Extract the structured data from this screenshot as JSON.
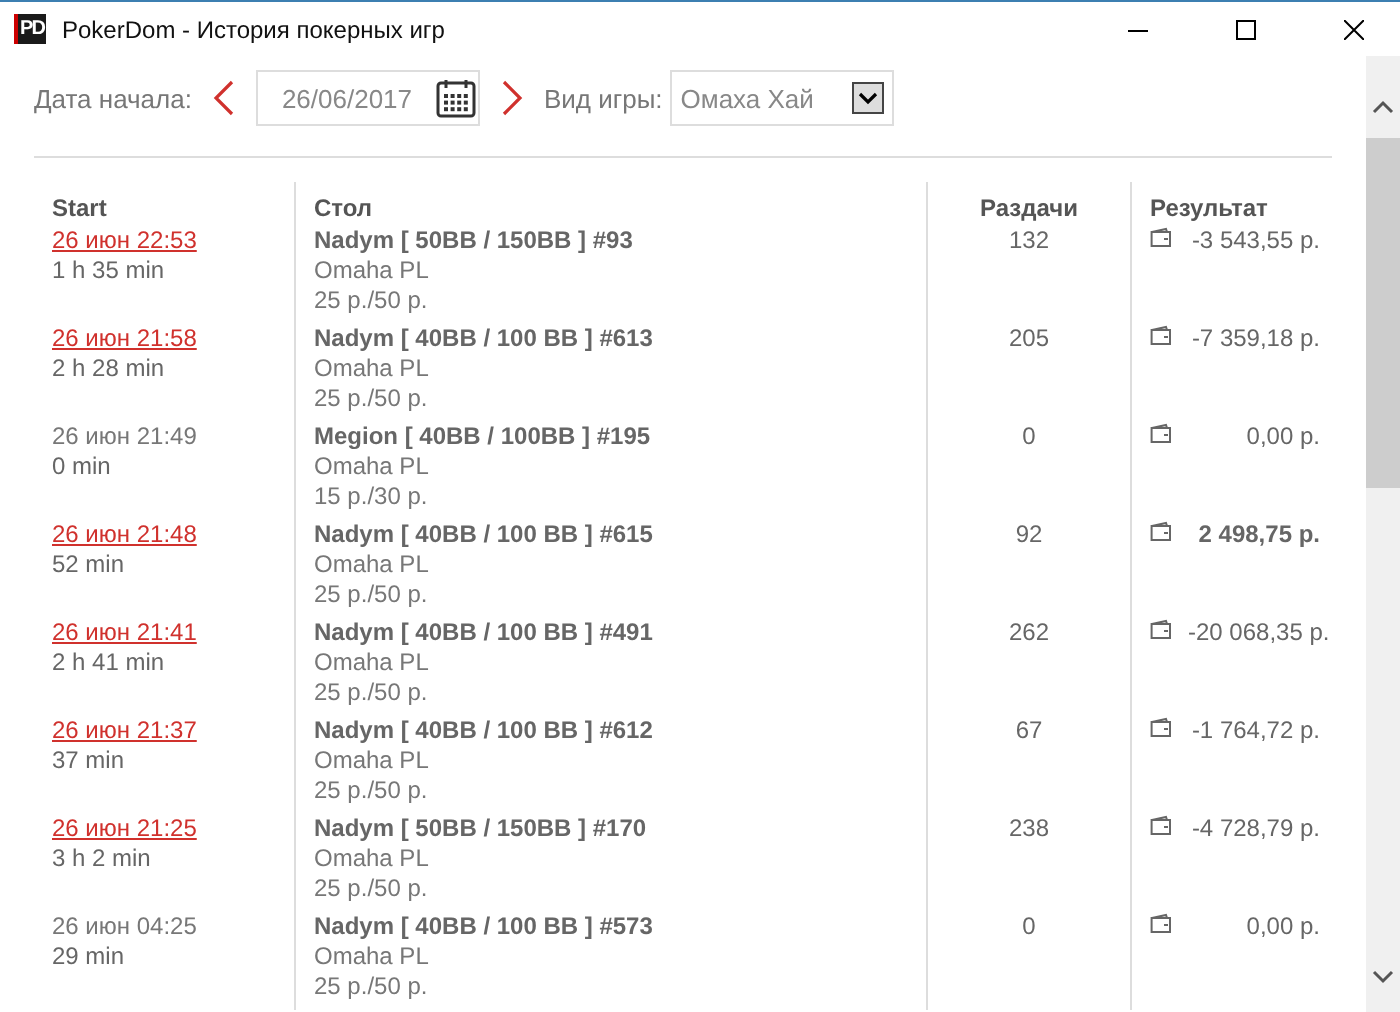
{
  "window": {
    "title": "PokerDom - История покерных игр",
    "logo": "PD"
  },
  "filters": {
    "date_label": "Дата начала:",
    "date": "26/06/2017",
    "game_label": "Вид игры:",
    "game": "Омаха Хай"
  },
  "columns": [
    "Start",
    "Стол",
    "Раздачи",
    "Результат"
  ],
  "rows": [
    {
      "start": "26 июн 22:53",
      "linked": true,
      "duration": "1 h 35 min",
      "table": "Nadym [ 50BB / 150BB ] #93",
      "game": "Omaha PL",
      "stakes": "25 р./50 р.",
      "hands": "132",
      "result": "-3 543,55 р.",
      "bold": false
    },
    {
      "start": "26 июн 21:58",
      "linked": true,
      "duration": "2 h 28 min",
      "table": "Nadym [ 40BB / 100 BB ] #613",
      "game": "Omaha PL",
      "stakes": "25 р./50 р.",
      "hands": "205",
      "result": "-7 359,18 р.",
      "bold": false
    },
    {
      "start": "26 июн 21:49",
      "linked": false,
      "duration": "0 min",
      "table": "Megion [ 40BB / 100BB ] #195",
      "game": "Omaha PL",
      "stakes": "15 р./30 р.",
      "hands": "0",
      "result": "0,00 р.",
      "bold": false
    },
    {
      "start": "26 июн 21:48",
      "linked": true,
      "duration": "52 min",
      "table": "Nadym [ 40BB / 100 BB ] #615",
      "game": "Omaha PL",
      "stakes": "25 р./50 р.",
      "hands": "92",
      "result": "2 498,75 р.",
      "bold": true
    },
    {
      "start": "26 июн 21:41",
      "linked": true,
      "duration": "2 h 41 min",
      "table": "Nadym [ 40BB / 100 BB ] #491",
      "game": "Omaha PL",
      "stakes": "25 р./50 р.",
      "hands": "262",
      "result": "-20 068,35 р.",
      "bold": false
    },
    {
      "start": "26 июн 21:37",
      "linked": true,
      "duration": "37 min",
      "table": "Nadym [ 40BB / 100 BB ] #612",
      "game": "Omaha PL",
      "stakes": "25 р./50 р.",
      "hands": "67",
      "result": "-1 764,72 р.",
      "bold": false
    },
    {
      "start": "26 июн 21:25",
      "linked": true,
      "duration": "3 h 2 min",
      "table": "Nadym [ 50BB / 150BB ] #170",
      "game": "Omaha PL",
      "stakes": "25 р./50 р.",
      "hands": "238",
      "result": "-4 728,79 р.",
      "bold": false
    },
    {
      "start": "26 июн 04:25",
      "linked": false,
      "duration": "29 min",
      "table": "Nadym [ 40BB / 100 BB ] #573",
      "game": "Omaha PL",
      "stakes": "25 р./50 р.",
      "hands": "0",
      "result": "0,00 р.",
      "bold": false
    }
  ]
}
